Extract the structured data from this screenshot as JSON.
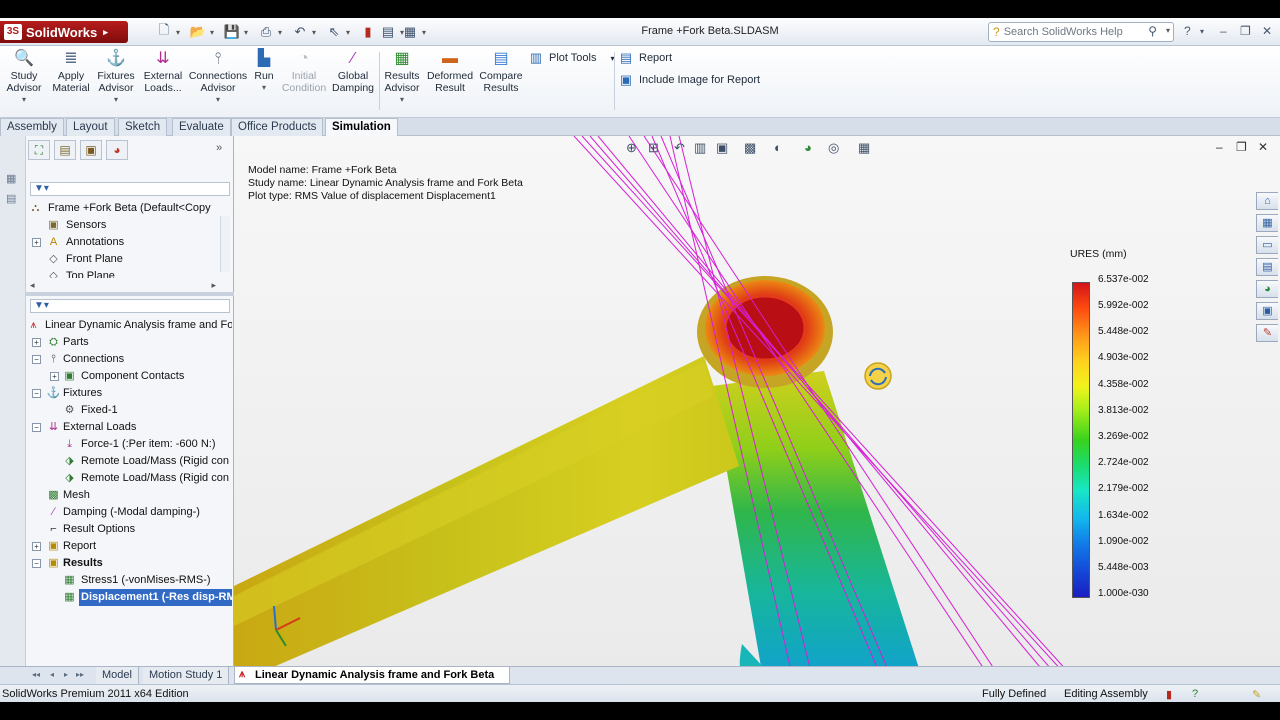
{
  "app": {
    "brand": "SolidWorks",
    "document_title": "Frame +Fork Beta.SLDASM",
    "search_placeholder": "Search SolidWorks Help"
  },
  "commands": [
    {
      "label": "Study Advisor",
      "icon": "study-advisor-icon",
      "enabled": true
    },
    {
      "label": "Apply Material",
      "icon": "apply-material-icon",
      "enabled": true
    },
    {
      "label": "Fixtures Advisor",
      "icon": "fixtures-advisor-icon",
      "enabled": true
    },
    {
      "label": "External Loads...",
      "icon": "external-loads-icon",
      "enabled": true
    },
    {
      "label": "Connections Advisor",
      "icon": "connections-advisor-icon",
      "enabled": true
    },
    {
      "label": "Run",
      "icon": "run-icon",
      "enabled": true
    },
    {
      "label": "Initial Condition",
      "icon": "initial-condition-icon",
      "enabled": false
    },
    {
      "label": "Global Damping",
      "icon": "global-damping-icon",
      "enabled": true
    },
    {
      "label": "Results Advisor",
      "icon": "results-advisor-icon",
      "enabled": true
    },
    {
      "label": "Deformed Result",
      "icon": "deformed-result-icon",
      "enabled": true
    },
    {
      "label": "Compare Results",
      "icon": "compare-results-icon",
      "enabled": true
    }
  ],
  "row_commands": {
    "plot_tools": "Plot Tools",
    "report": "Report",
    "include_image": "Include Image for Report"
  },
  "cm_tabs": [
    "Assembly",
    "Layout",
    "Sketch",
    "Evaluate",
    "Office Products",
    "Simulation"
  ],
  "active_cm_tab": "Simulation",
  "feature_tree": {
    "root": "Frame +Fork Beta  (Default<Copy",
    "items": [
      "Sensors",
      "Annotations",
      "Front Plane",
      "Top Plane"
    ]
  },
  "study_tree": {
    "root": "Linear Dynamic Analysis frame and Fo",
    "parts": "Parts",
    "connections": "Connections",
    "component_contacts": "Component Contacts",
    "fixtures": "Fixtures",
    "fixed1": "Fixed-1",
    "external_loads": "External Loads",
    "force1": "Force-1 (:Per item: -600 N:)",
    "remote1": "Remote Load/Mass (Rigid con",
    "remote2": "Remote Load/Mass (Rigid con",
    "mesh": "Mesh",
    "damping": "Damping (-Modal damping-)",
    "result_options": "Result Options",
    "report": "Report",
    "results": "Results",
    "stress1": "Stress1 (-vonMises-RMS-)",
    "displacement1": "Displacement1 (-Res disp-RM"
  },
  "viewport": {
    "model_name": "Model name: Frame +Fork Beta",
    "study_name": "Study name: Linear Dynamic Analysis frame and Fork Beta",
    "plot_type": "Plot type: RMS Value of displacement Displacement1"
  },
  "legend": {
    "title": "URES (mm)",
    "ticks": [
      "6.537e-002",
      "5.992e-002",
      "5.448e-002",
      "4.903e-002",
      "4.358e-002",
      "3.813e-002",
      "3.269e-002",
      "2.724e-002",
      "2.179e-002",
      "1.634e-002",
      "1.090e-002",
      "5.448e-003",
      "1.000e-030"
    ],
    "max_color": "#d3141a",
    "min_color": "#1a1ec0"
  },
  "bottom_tabs": [
    "Model",
    "Motion Study 1",
    "Linear Dynamic Analysis frame and Fork Beta"
  ],
  "active_bottom_tab": "Linear Dynamic Analysis frame and Fork Beta",
  "status": {
    "edition": "SolidWorks Premium 2011 x64 Edition",
    "definition": "Fully Defined",
    "mode": "Editing Assembly"
  }
}
